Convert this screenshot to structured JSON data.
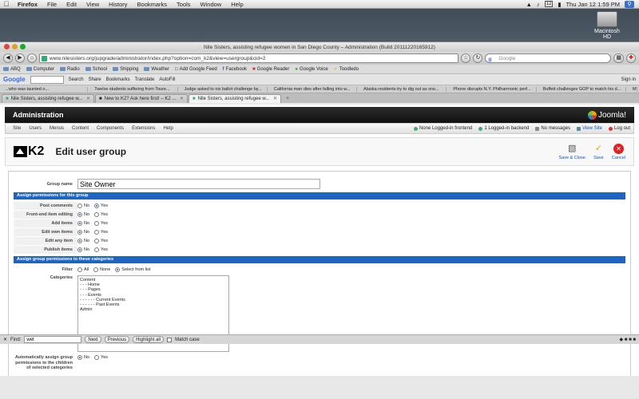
{
  "menubar": {
    "app": "Firefox",
    "items": [
      "File",
      "Edit",
      "View",
      "History",
      "Bookmarks",
      "Tools",
      "Window",
      "Help"
    ],
    "clock": "Thu Jan 12  1:59 PM",
    "calendar_badge": "12"
  },
  "desktop": {
    "hd_label": "Macintosh HD"
  },
  "window": {
    "title": "Nile Sisters, assisting refugee women in San Diego County – Administration (Build 20111220165912)",
    "url": "www.nilesisters.org/jupgrade/administrator/index.php?option=com_k2&view=usergroup&cid=2",
    "search_placeholder": "Google"
  },
  "bookmarks": [
    "ABQ",
    "Computer",
    "Radio",
    "School",
    "Shipping",
    "Weather",
    "Add Google Feed",
    "Facebook",
    "Google Reader",
    "Google Voice",
    "Toodledo"
  ],
  "google_toolbar": {
    "items": [
      "Search",
      "Share",
      "Bookmarks",
      "Translate",
      "AutoFill"
    ],
    "signin": "Sign in"
  },
  "ticker": [
    "...who was taunted o...",
    "Twelve students suffering from Toure...",
    "Judge asked to nix ballot challenge by...",
    "California man dies after falling into w...",
    "Alaska residents try to dig out as sno...",
    "Phone disrupts N.Y. Philharmonic perf...",
    "Buffett challenges GOP to match his d...",
    "M"
  ],
  "tabs": [
    {
      "label": "Nile Sisters, assisting refugee w...",
      "active": false
    },
    {
      "label": "New to K2? Ask here first! – K2 ...",
      "active": false
    },
    {
      "label": "Nile Sisters, assisting refugee w...",
      "active": true
    }
  ],
  "admin": {
    "title": "Administration",
    "brand": "Joomla!",
    "menu": [
      "Site",
      "Users",
      "Menus",
      "Content",
      "Components",
      "Extensions",
      "Help"
    ],
    "status": [
      "None Logged-in frontend",
      "1 Logged-in backend",
      "No messages",
      "View Site",
      "Log out"
    ]
  },
  "toolbar": {
    "logo": "K2",
    "page_title": "Edit user group",
    "save_close": "Save & Close",
    "save": "Save",
    "cancel": "Cancel"
  },
  "form": {
    "group_name_label": "Group name",
    "group_name_value": "Site Owner",
    "perm_header": "Assign permissions for this group",
    "perms": [
      {
        "label": "Post comments",
        "value": "Yes"
      },
      {
        "label": "Front-end item editing",
        "value": "No"
      },
      {
        "label": "Add items",
        "value": "No"
      },
      {
        "label": "Edit own items",
        "value": "No"
      },
      {
        "label": "Edit any item",
        "value": "No"
      },
      {
        "label": "Publish items",
        "value": "No"
      }
    ],
    "no_label": "No",
    "yes_label": "Yes",
    "cat_header": "Assign group permissions to these categories",
    "filter_label": "Filter",
    "filter_options": [
      "All",
      "None",
      "Select from list"
    ],
    "filter_value": "Select from list",
    "categories_label": "Categories",
    "categories": [
      "Content",
      "- - - Home",
      "- - - Pages",
      "- - - Events",
      "- - - - - - Current Events",
      "- - - - - - Past Events",
      "Admin"
    ],
    "auto_label": "Automatically assign group permissions to the children of selected categories",
    "auto_value": "No"
  },
  "findbar": {
    "label": "Find:",
    "value": "wet",
    "next": "Next",
    "previous": "Previous",
    "highlight": "Highlight all",
    "match_case": "Match case"
  }
}
